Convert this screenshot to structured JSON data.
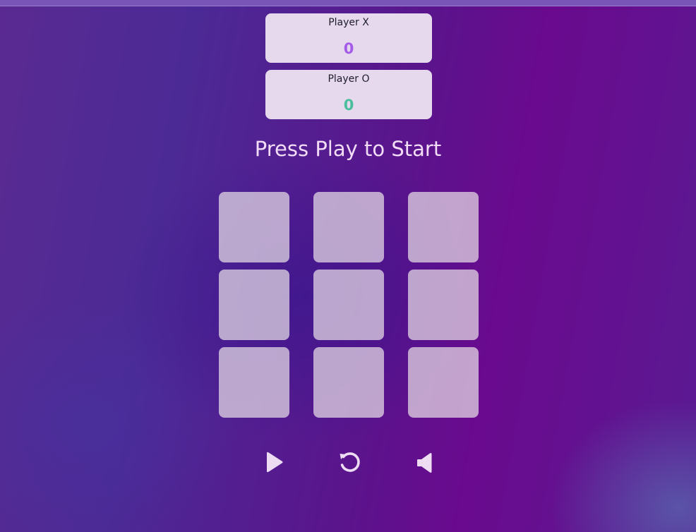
{
  "scoreboard": {
    "player_x": {
      "label": "Player X",
      "score": "0",
      "color": "#a35be8"
    },
    "player_o": {
      "label": "Player O",
      "score": "0",
      "color": "#4bbf9d"
    }
  },
  "status": {
    "message": "Press Play to Start"
  },
  "board": {
    "cells": [
      "",
      "",
      "",
      "",
      "",
      "",
      "",
      "",
      ""
    ]
  },
  "controls": {
    "play": {
      "icon": "play-icon"
    },
    "reset": {
      "icon": "restart-icon"
    },
    "sound": {
      "icon": "speaker-icon"
    }
  },
  "colors": {
    "background": "#5a148c",
    "card": "#e6d9ee",
    "cell": "#d8c4dc",
    "status_text": "#f2dcf6",
    "icon": "#eddcf2"
  }
}
